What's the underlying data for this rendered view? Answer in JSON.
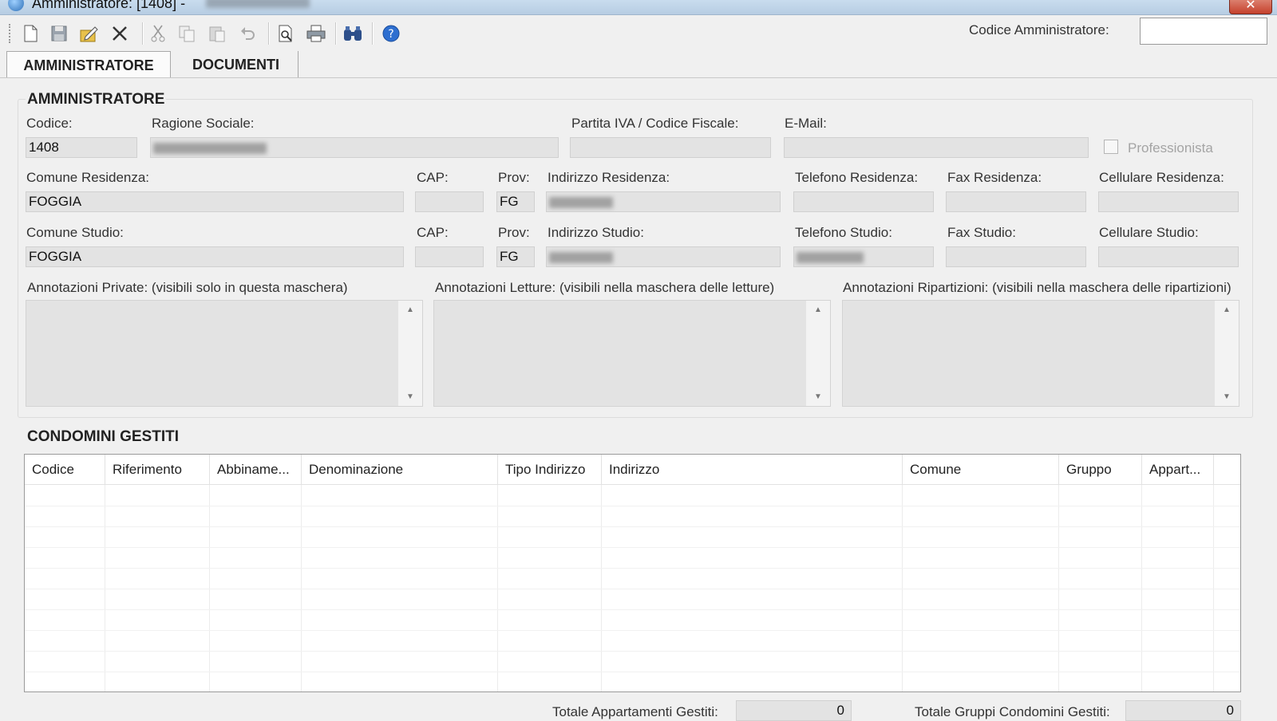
{
  "window": {
    "title": "Amministratore: [1408] -",
    "close_symbol": "✕"
  },
  "toolbar": {
    "buttons": [
      "new-icon",
      "save-icon",
      "edit-icon",
      "delete-icon",
      "cut-icon",
      "copy-icon",
      "paste-icon",
      "undo-icon",
      "print-preview-icon",
      "print-icon",
      "find-icon",
      "help-icon"
    ],
    "code_label": "Codice Amministratore:",
    "code_value": ""
  },
  "tabs": [
    {
      "label": "AMMINISTRATORE",
      "active": true
    },
    {
      "label": "DOCUMENTI",
      "active": false
    }
  ],
  "admin": {
    "section_title": "AMMINISTRATORE",
    "codice": {
      "label": "Codice:",
      "value": "1408"
    },
    "ragione_sociale": {
      "label": "Ragione Sociale:",
      "value": ""
    },
    "partita_iva": {
      "label": "Partita IVA / Codice Fiscale:",
      "value": ""
    },
    "email": {
      "label": "E-Mail:",
      "value": ""
    },
    "professionista": {
      "label": "Professionista",
      "checked": false
    },
    "residenza": {
      "comune": {
        "label": "Comune Residenza:",
        "value": "FOGGIA"
      },
      "cap": {
        "label": "CAP:",
        "value": ""
      },
      "prov": {
        "label": "Prov:",
        "value": "FG"
      },
      "indirizzo": {
        "label": "Indirizzo Residenza:",
        "value": ""
      },
      "telefono": {
        "label": "Telefono Residenza:",
        "value": ""
      },
      "fax": {
        "label": "Fax Residenza:",
        "value": ""
      },
      "cellulare": {
        "label": "Cellulare Residenza:",
        "value": ""
      }
    },
    "studio": {
      "comune": {
        "label": "Comune Studio:",
        "value": "FOGGIA"
      },
      "cap": {
        "label": "CAP:",
        "value": ""
      },
      "prov": {
        "label": "Prov:",
        "value": "FG"
      },
      "indirizzo": {
        "label": "Indirizzo Studio:",
        "value": ""
      },
      "telefono": {
        "label": "Telefono Studio:",
        "value": ""
      },
      "fax": {
        "label": "Fax Studio:",
        "value": ""
      },
      "cellulare": {
        "label": "Cellulare Studio:",
        "value": ""
      }
    },
    "annotazioni": {
      "private": {
        "label": "Annotazioni Private: (visibili solo in questa maschera)",
        "value": ""
      },
      "letture": {
        "label": "Annotazioni Letture: (visibili nella maschera delle letture)",
        "value": ""
      },
      "ripartizioni": {
        "label": "Annotazioni Ripartizioni: (visibili nella maschera delle ripartizioni)",
        "value": ""
      }
    }
  },
  "condomini": {
    "section_title": "CONDOMINI GESTITI",
    "columns": [
      "Codice",
      "Riferimento",
      "Abbiname...",
      "Denominazione",
      "Tipo Indirizzo",
      "Indirizzo",
      "Comune",
      "Gruppo",
      "Appart..."
    ],
    "rows": []
  },
  "totals": {
    "appartamenti": {
      "label": "Totale Appartamenti Gestiti:",
      "value": "0"
    },
    "gruppi": {
      "label": "Totale Gruppi Condomini Gestiti:",
      "value": "0"
    }
  },
  "colors": {
    "field_bg": "#e3e3e3",
    "window_bg": "#f0f0f0",
    "titlebar": "#c9dcee"
  }
}
